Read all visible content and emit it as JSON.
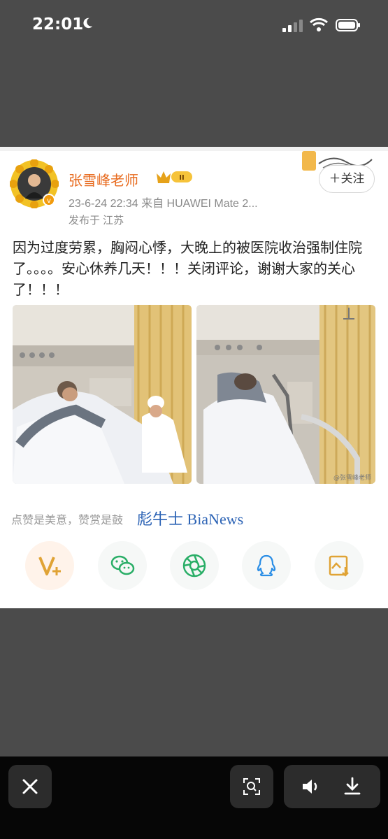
{
  "status_bar": {
    "time": "22:01"
  },
  "post": {
    "author": "张雪峰老师",
    "meta": "23-6-24 22:34  来自 HUAWEI Mate 2...",
    "location": "发布于 江苏",
    "follow_label": "＋关注",
    "text": "因为过度劳累，胸闷心悸，大晚上的被医院收治强制住院了。。。。安心休养几天！！！关闭评论，谢谢大家的关心了！！！",
    "reward_text": "点赞是美意，赞赏是鼓",
    "watermark": "BiaNews",
    "watermark_prefix": "彪牛士",
    "photo_watermark": "@张雪峰老师"
  },
  "share_buttons": [
    {
      "icon": "v-plus-icon",
      "color": "#e0a335"
    },
    {
      "icon": "wechat-icon",
      "color": "#2aae67"
    },
    {
      "icon": "moments-icon",
      "color": "#2aae67"
    },
    {
      "icon": "qq-icon",
      "color": "#2b8ee6"
    },
    {
      "icon": "save-image-icon",
      "color": "#e0a335"
    }
  ],
  "colors": {
    "accent": "#e86b1f",
    "link": "#2c63b5"
  }
}
